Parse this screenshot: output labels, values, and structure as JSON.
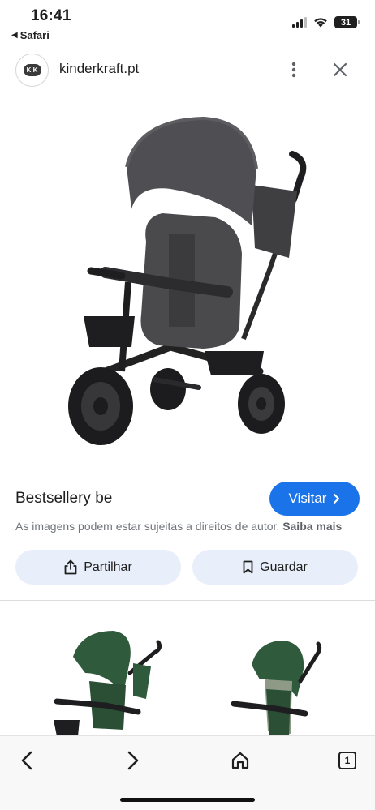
{
  "status_bar": {
    "time": "16:41",
    "back_app": "Safari",
    "battery": "31"
  },
  "site": {
    "logo_text": "K K",
    "name": "kinderkraft.pt"
  },
  "caption": {
    "title": "Bestsellery be",
    "visit_label": "Visitar",
    "rights_text": "As imagens podem estar sujeitas a direitos de autor.",
    "rights_link": "Saiba mais"
  },
  "actions": {
    "share_label": "Partilhar",
    "save_label": "Guardar"
  },
  "toolbar": {
    "tab_count": "1"
  },
  "colors": {
    "accent": "#1a73e8",
    "chip_bg": "#e8eefa",
    "product_gray": "#4a4a4d",
    "related_green": "#2f5a3c"
  }
}
